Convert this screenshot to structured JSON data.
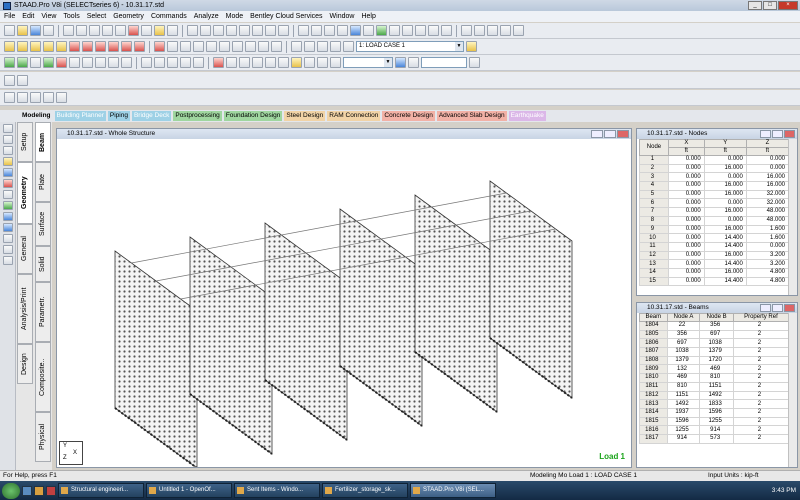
{
  "window": {
    "title": "STAAD.Pro V8i (SELECTseries 6) - 10.31.17.std",
    "buttons": [
      "_",
      "□",
      "×"
    ]
  },
  "menu": [
    "File",
    "Edit",
    "View",
    "Tools",
    "Select",
    "Geometry",
    "Commands",
    "Analyze",
    "Mode",
    "Bentley Cloud Services",
    "Window",
    "Help"
  ],
  "toolbar": {
    "load_case_selector": "1: LOAD CASE 1"
  },
  "page_tabs": [
    {
      "label": "Modeling",
      "color": "#e4e7ec"
    },
    {
      "label": "Building Planner",
      "color": "#9ed1e6"
    },
    {
      "label": "Piping",
      "color": "#9ed1e6"
    },
    {
      "label": "Bridge Deck",
      "color": "#9ed1e6"
    },
    {
      "label": "Postprocessing",
      "color": "#9fd69f"
    },
    {
      "label": "Foundation Design",
      "color": "#9fd69f"
    },
    {
      "label": "Steel Design",
      "color": "#f1d3a6"
    },
    {
      "label": "RAM Connection",
      "color": "#f1d3a6"
    },
    {
      "label": "Concrete Design",
      "color": "#f2b1a6"
    },
    {
      "label": "Advanced Slab Design",
      "color": "#f2b1a6"
    },
    {
      "label": "Earthquake",
      "color": "#dbb7e8"
    }
  ],
  "side_tabs": {
    "column1": [
      "Setup",
      "Geometry",
      "General",
      "Analysis/Print",
      "Design"
    ],
    "column2": [
      "Beam",
      "Plate",
      "Surface",
      "Solid",
      "Parametr.",
      "Composite..",
      "Physical"
    ]
  },
  "viewport": {
    "title": "10.31.17.std - Whole Structure",
    "load_label": "Load 1",
    "axis_labels": [
      "Y",
      "Z",
      "X"
    ]
  },
  "nodes_table": {
    "title": "10.31.17.std - Nodes",
    "headers": [
      "Node",
      "X",
      "Y",
      "Z"
    ],
    "units": [
      "",
      "ft",
      "ft",
      "ft"
    ],
    "rows": [
      [
        "1",
        "0.000",
        "0.000",
        "0.000"
      ],
      [
        "2",
        "0.000",
        "16.000",
        "0.000"
      ],
      [
        "3",
        "0.000",
        "0.000",
        "16.000"
      ],
      [
        "4",
        "0.000",
        "16.000",
        "16.000"
      ],
      [
        "5",
        "0.000",
        "16.000",
        "32.000"
      ],
      [
        "6",
        "0.000",
        "0.000",
        "32.000"
      ],
      [
        "7",
        "0.000",
        "16.000",
        "48.000"
      ],
      [
        "8",
        "0.000",
        "0.000",
        "48.000"
      ],
      [
        "9",
        "0.000",
        "16.000",
        "1.600"
      ],
      [
        "10",
        "0.000",
        "14.400",
        "1.600"
      ],
      [
        "11",
        "0.000",
        "14.400",
        "0.000"
      ],
      [
        "12",
        "0.000",
        "16.000",
        "3.200"
      ],
      [
        "13",
        "0.000",
        "14.400",
        "3.200"
      ],
      [
        "14",
        "0.000",
        "16.000",
        "4.800"
      ],
      [
        "15",
        "0.000",
        "14.400",
        "4.800"
      ]
    ]
  },
  "beams_table": {
    "title": "10.31.17.std - Beams",
    "headers": [
      "Beam",
      "Node A",
      "Node B",
      "Property Ref"
    ],
    "rows": [
      [
        "1804",
        "22",
        "356",
        "2"
      ],
      [
        "1805",
        "356",
        "697",
        "2"
      ],
      [
        "1806",
        "697",
        "1038",
        "2"
      ],
      [
        "1807",
        "1038",
        "1379",
        "2"
      ],
      [
        "1808",
        "1379",
        "1720",
        "2"
      ],
      [
        "1809",
        "132",
        "469",
        "2"
      ],
      [
        "1810",
        "469",
        "810",
        "2"
      ],
      [
        "1811",
        "810",
        "1151",
        "2"
      ],
      [
        "1812",
        "1151",
        "1492",
        "2"
      ],
      [
        "1813",
        "1492",
        "1833",
        "2"
      ],
      [
        "1814",
        "1937",
        "1596",
        "2"
      ],
      [
        "1815",
        "1596",
        "1255",
        "2"
      ],
      [
        "1816",
        "1255",
        "914",
        "2"
      ],
      [
        "1817",
        "914",
        "573",
        "2"
      ]
    ]
  },
  "status": {
    "help": "For Help, press F1",
    "mode": "Modeling Mo",
    "load": "Load 1 : LOAD CASE 1",
    "units": "Input Units : kip-ft"
  },
  "taskbar": {
    "tasks": [
      {
        "label": "Structural engineeri...",
        "active": false
      },
      {
        "label": "Untitled 1 - OpenOf...",
        "active": false
      },
      {
        "label": "Sent Items - Windo...",
        "active": false
      },
      {
        "label": "Fertilizer_storage_sk...",
        "active": false
      },
      {
        "label": "STAAD.Pro V8i (SEL...",
        "active": true
      }
    ],
    "clock": "3:43 PM"
  }
}
